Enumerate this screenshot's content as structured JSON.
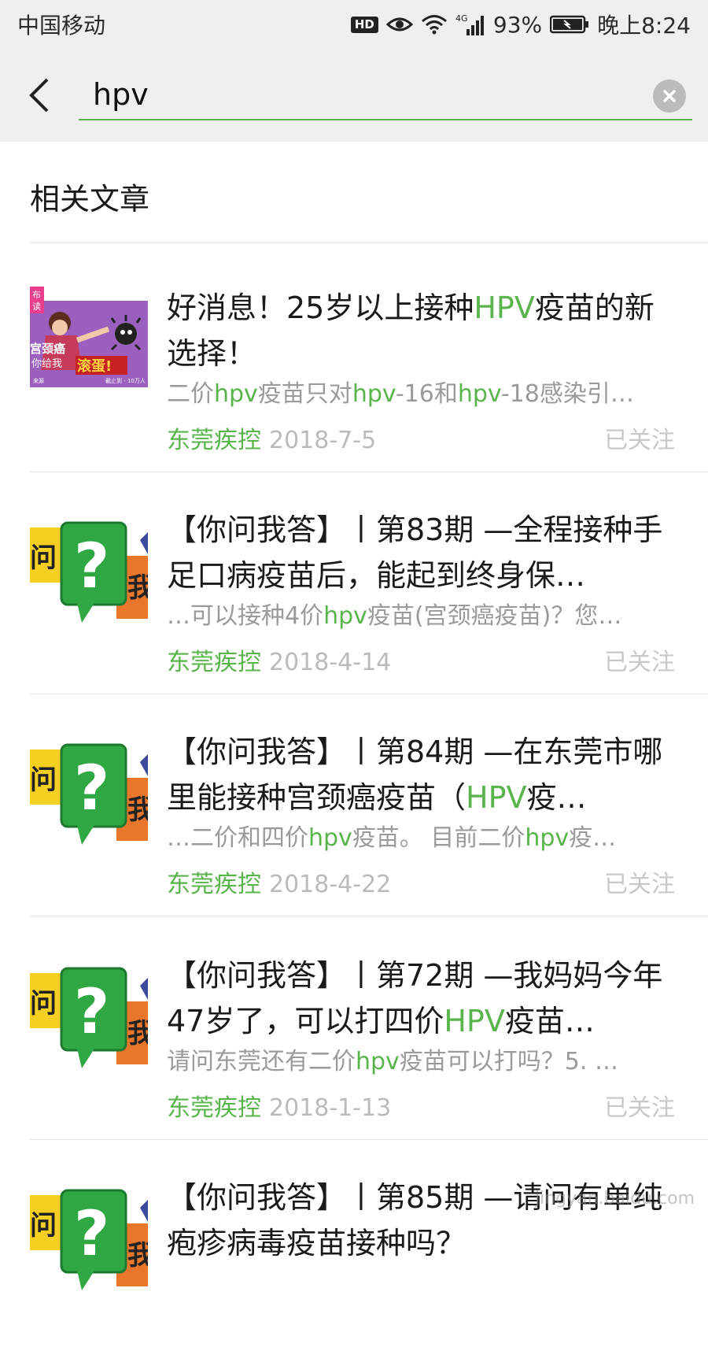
{
  "status_bar": {
    "carrier": "中国移动",
    "hd": "HD",
    "network": "4G",
    "battery": "93%",
    "time": "晚上8:24"
  },
  "search": {
    "query": "hpv",
    "back_icon": "back-arrow-icon",
    "clear_icon": "clear-icon"
  },
  "section_title": "相关文章",
  "accent_color": "#58b44b",
  "results": [
    {
      "title_parts": [
        "好消息！25岁以上接种",
        "HPV",
        "疫苗的新选择！"
      ],
      "desc_parts": [
        "二价",
        "hpv",
        "疫苗只对",
        "hpv",
        "-16和",
        "hpv",
        "-18感染引…"
      ],
      "source": "东莞疾控",
      "date": "2018-7-5",
      "follow": "已关注",
      "thumb_text": [
        "布",
        "读",
        "宫颈癌",
        "你给我",
        "滚蛋!",
        "截止到 - 10万人",
        "来源"
      ]
    },
    {
      "title_parts": [
        "【你问我答】丨第83期 —全程接种手足口病疫苗后，能起到终身保…"
      ],
      "desc_parts": [
        "…可以接种4价",
        "hpv",
        "疫苗(宫颈癌疫苗)？您…"
      ],
      "source": "东莞疾控",
      "date": "2018-4-14",
      "follow": "已关注",
      "thumb_text": [
        "问",
        "?",
        "我"
      ]
    },
    {
      "title_parts": [
        "【你问我答】丨第84期 —在东莞市哪里能接种宫颈癌疫苗（",
        "HPV",
        "疫…"
      ],
      "desc_parts": [
        "…二价和四价",
        "hpv",
        "疫苗。 目前二价",
        "hpv",
        "疫…"
      ],
      "source": "东莞疾控",
      "date": "2018-4-22",
      "follow": "已关注",
      "thumb_text": [
        "问",
        "?",
        "我"
      ]
    },
    {
      "title_parts": [
        "【你问我答】丨第72期 —我妈妈今年47岁了，可以打四价",
        "HPV",
        "疫苗…"
      ],
      "desc_parts": [
        "请问东莞还有二价",
        "hpv",
        "疫苗可以打吗？5. …"
      ],
      "source": "东莞疾控",
      "date": "2018-1-13",
      "follow": "已关注",
      "thumb_text": [
        "问",
        "?",
        "我"
      ]
    },
    {
      "title_parts": [
        "【你问我答】丨第85期 —请问有单纯疱疹病毒疫苗接种吗？"
      ],
      "desc_parts": [],
      "source": "",
      "date": "",
      "follow": "",
      "thumb_text": [
        "问",
        "?",
        "我"
      ]
    }
  ],
  "watermark": "jingyan.baidu.com"
}
